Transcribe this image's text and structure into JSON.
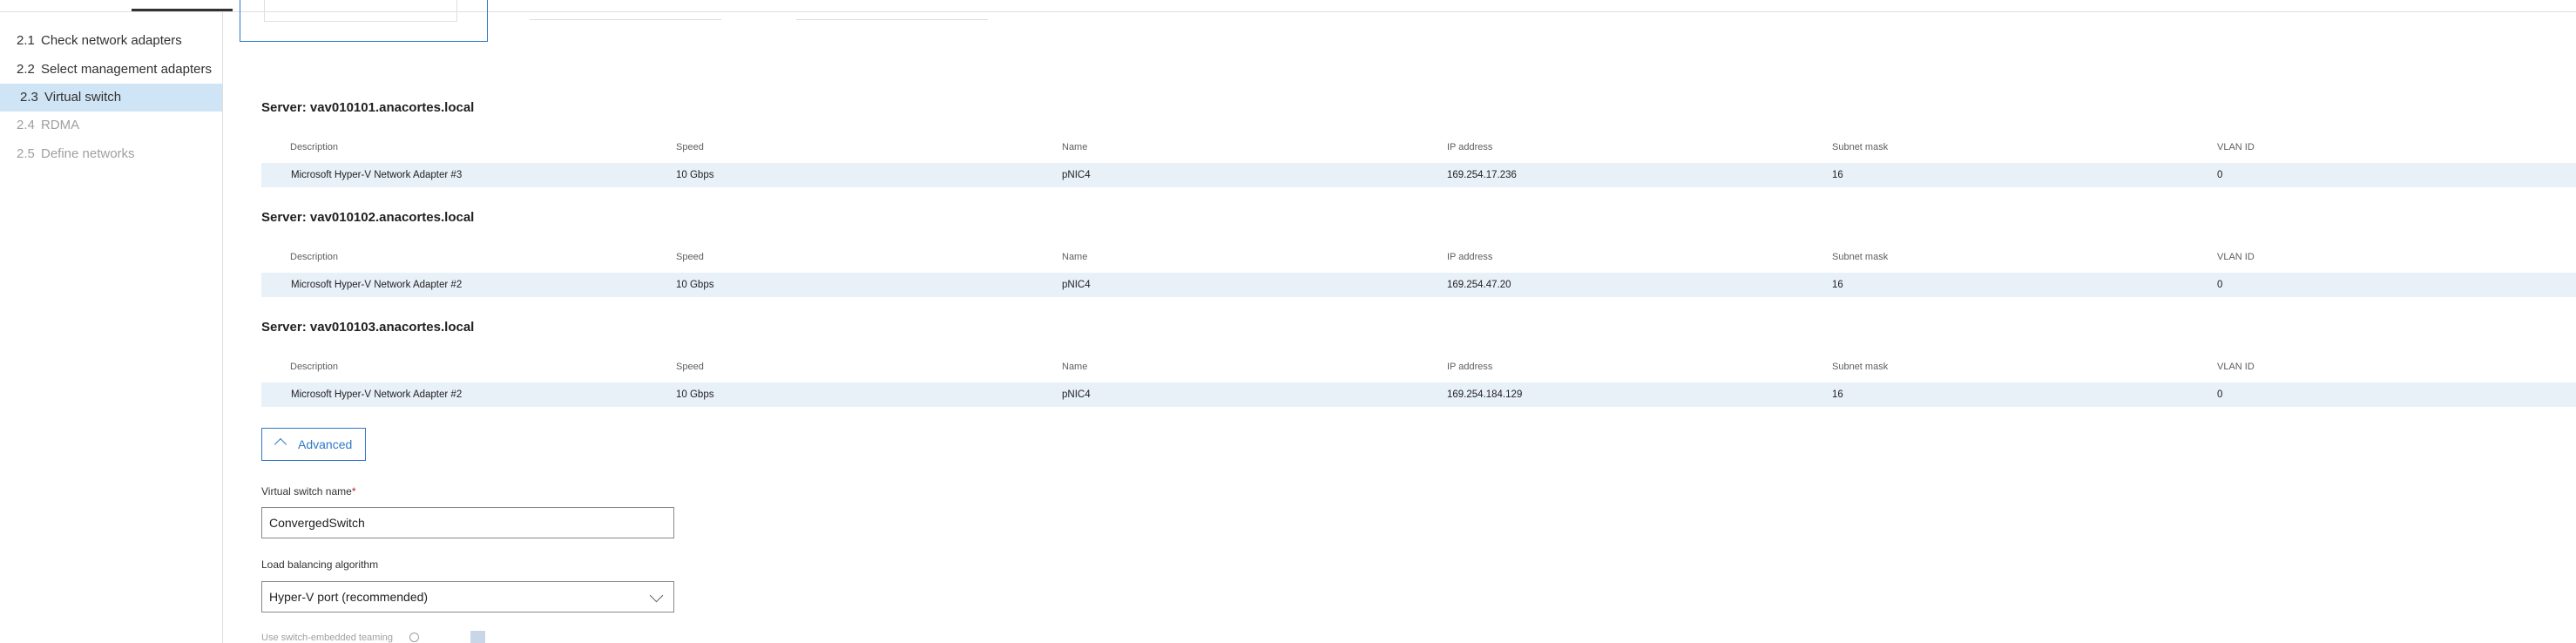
{
  "nav": {
    "items": [
      {
        "num": "2.1",
        "label": "Check network adapters",
        "state": "normal"
      },
      {
        "num": "2.2",
        "label": "Select management adapters",
        "state": "normal"
      },
      {
        "num": "2.3",
        "label": "Virtual switch",
        "state": "active"
      },
      {
        "num": "2.4",
        "label": "RDMA",
        "state": "disabled"
      },
      {
        "num": "2.5",
        "label": "Define networks",
        "state": "disabled"
      }
    ]
  },
  "table_headers": [
    "Description",
    "Speed",
    "Name",
    "IP address",
    "Subnet mask",
    "VLAN ID"
  ],
  "servers": [
    {
      "title": "Server: vav010101.anacortes.local",
      "row": [
        "Microsoft Hyper-V Network Adapter #3",
        "10 Gbps",
        "pNIC4",
        "169.254.17.236",
        "16",
        "0"
      ]
    },
    {
      "title": "Server: vav010102.anacortes.local",
      "row": [
        "Microsoft Hyper-V Network Adapter #2",
        "10 Gbps",
        "pNIC4",
        "169.254.47.20",
        "16",
        "0"
      ]
    },
    {
      "title": "Server: vav010103.anacortes.local",
      "row": [
        "Microsoft Hyper-V Network Adapter #2",
        "10 Gbps",
        "pNIC4",
        "169.254.184.129",
        "16",
        "0"
      ]
    }
  ],
  "advanced": {
    "label": "Advanced",
    "icon": "chevron-up-icon"
  },
  "form": {
    "switch_name_label": "Virtual switch name",
    "required_mark": "*",
    "switch_name_value": "ConvergedSwitch",
    "lb_label": "Load balancing algorithm",
    "lb_value": "Hyper-V port (recommended)",
    "set_label": "Use switch-embedded teaming"
  },
  "colors": {
    "accent": "#2f78c5",
    "active_nav": "#cfe4f5",
    "row_bg": "#e8f0f8"
  }
}
